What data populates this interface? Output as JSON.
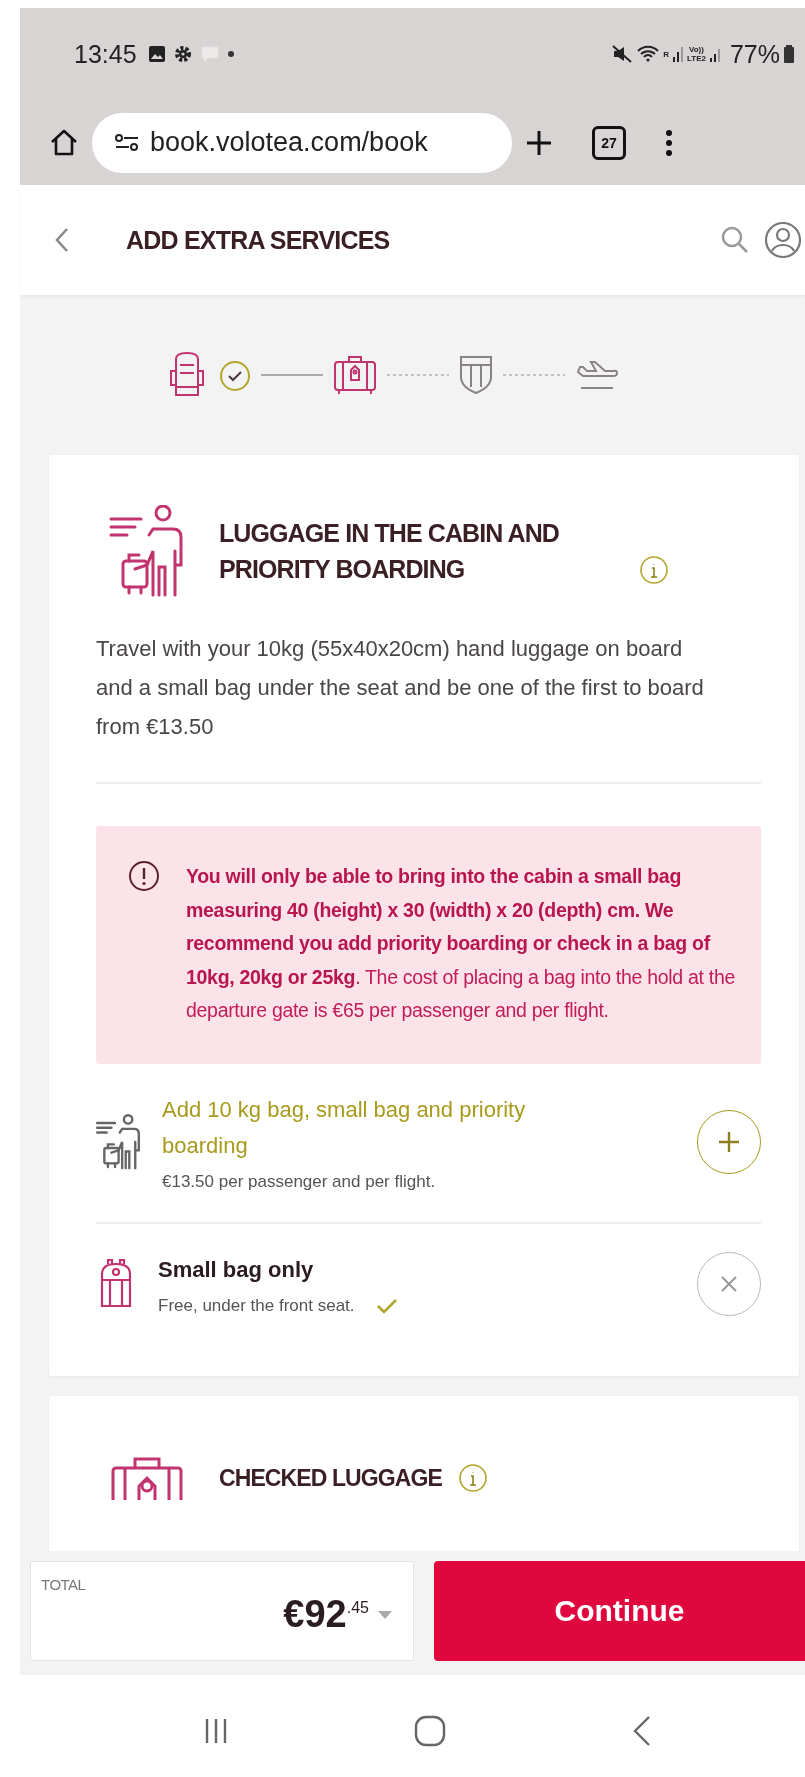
{
  "status_bar": {
    "time": "13:45",
    "roaming_label": "R",
    "volte_label": "Vo))",
    "lte_label": "LTE2",
    "battery": "77%"
  },
  "browser": {
    "url": "book.volotea.com/book",
    "tab_count": "27"
  },
  "header": {
    "title": "ADD EXTRA SERVICES"
  },
  "stepper": [
    {
      "kind": "seat",
      "done": true,
      "active": true
    },
    {
      "kind": "luggage",
      "done": false,
      "active": true
    },
    {
      "kind": "insurance",
      "done": false,
      "active": false
    },
    {
      "kind": "flight",
      "done": false,
      "active": false
    }
  ],
  "cabin_card": {
    "title": "LUGGAGE IN THE CABIN AND PRIORITY BOARDING",
    "description": "Travel with your 10kg (55x40x20cm) hand luggage on board and a small bag under the seat and be one of the first to board from €13.50",
    "alert": "**You will only be able to bring into the cabin a small bag measuring 40 (height) x 30 (width) x 20 (depth) cm. We recommend you add priority boarding or check in a bag of 10kg, 20kg or 25kg**. The cost of placing a bag into the hold at the departure gate is €65 per passenger and per flight.",
    "options": [
      {
        "kind": "priority",
        "title": "Add 10 kg bag, small bag and priority boarding",
        "subtitle": "€13.50 per passenger and per flight.",
        "selected": false
      },
      {
        "kind": "small_bag",
        "title": "Small bag only",
        "subtitle": "Free, under the front seat.",
        "selected": true
      }
    ]
  },
  "checked_card": {
    "title": "CHECKED LUGGAGE"
  },
  "footer": {
    "total_label": "TOTAL",
    "total": "€92$^{.45}$",
    "continue": "Continue"
  }
}
